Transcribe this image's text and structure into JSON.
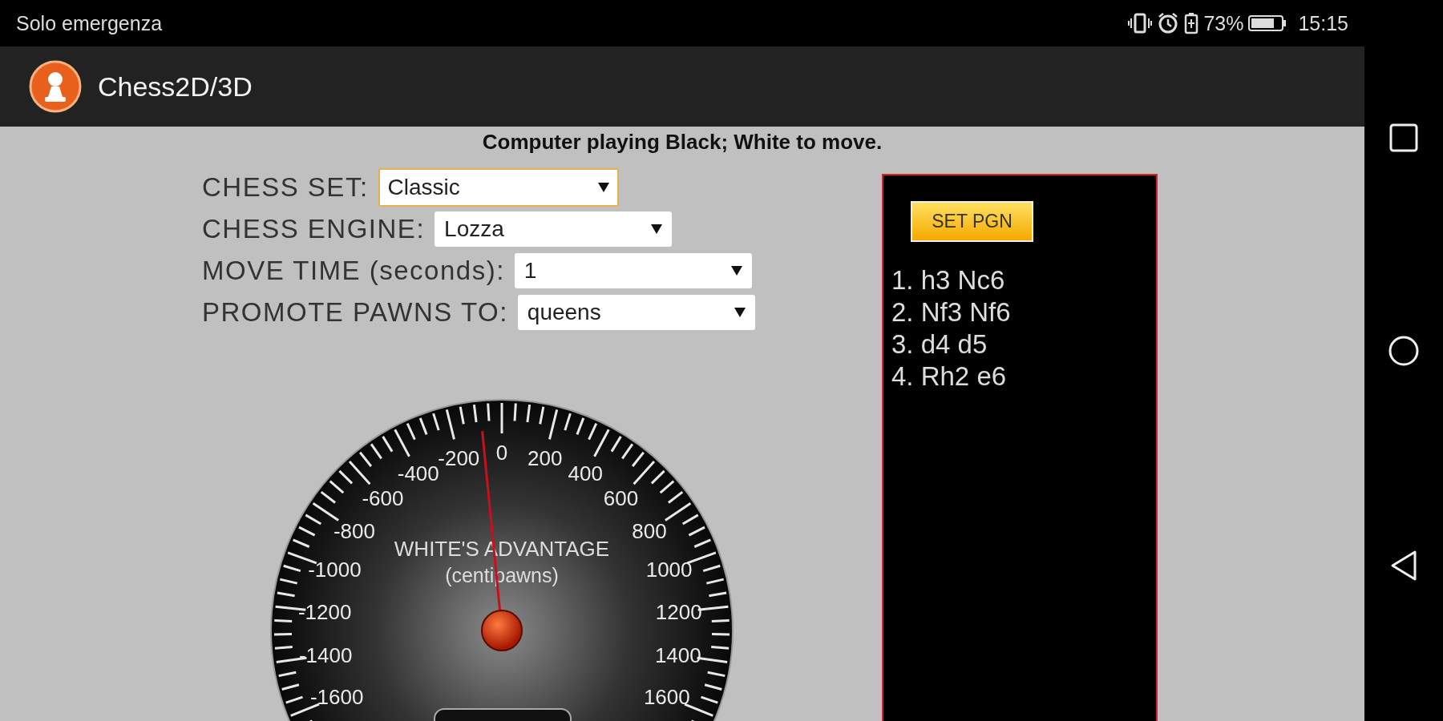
{
  "status_bar": {
    "carrier": "Solo emergenza",
    "battery_percent": "73%",
    "time": "15:15"
  },
  "app_bar": {
    "title": "Chess2D/3D"
  },
  "status_message": "Computer playing Black; White to move.",
  "settings": [
    {
      "label": "CHESS SET:",
      "value": "Classic",
      "focused": true
    },
    {
      "label": "CHESS ENGINE:",
      "value": "Lozza",
      "focused": false
    },
    {
      "label": "MOVE TIME (seconds):",
      "value": "1",
      "focused": false
    },
    {
      "label": "PROMOTE PAWNS TO:",
      "value": "queens",
      "focused": false
    }
  ],
  "gauge": {
    "title": "WHITE'S ADVANTAGE",
    "subtitle": "(centipawns)",
    "left_scale": [
      "-200",
      "-400",
      "-600",
      "-800",
      "-1000",
      "-1200",
      "-1400",
      "-1600"
    ],
    "top_label": "0",
    "right_scale": [
      "200",
      "400",
      "600",
      "800",
      "1000",
      "1200",
      "1400",
      "1600"
    ],
    "level": 0.48
  },
  "pgn_panel": {
    "button": "SET PGN",
    "moves": [
      "1. h3 Nc6",
      "2. Nf3 Nf6",
      "3. d4 d5",
      "4. Rh2 e6"
    ]
  }
}
